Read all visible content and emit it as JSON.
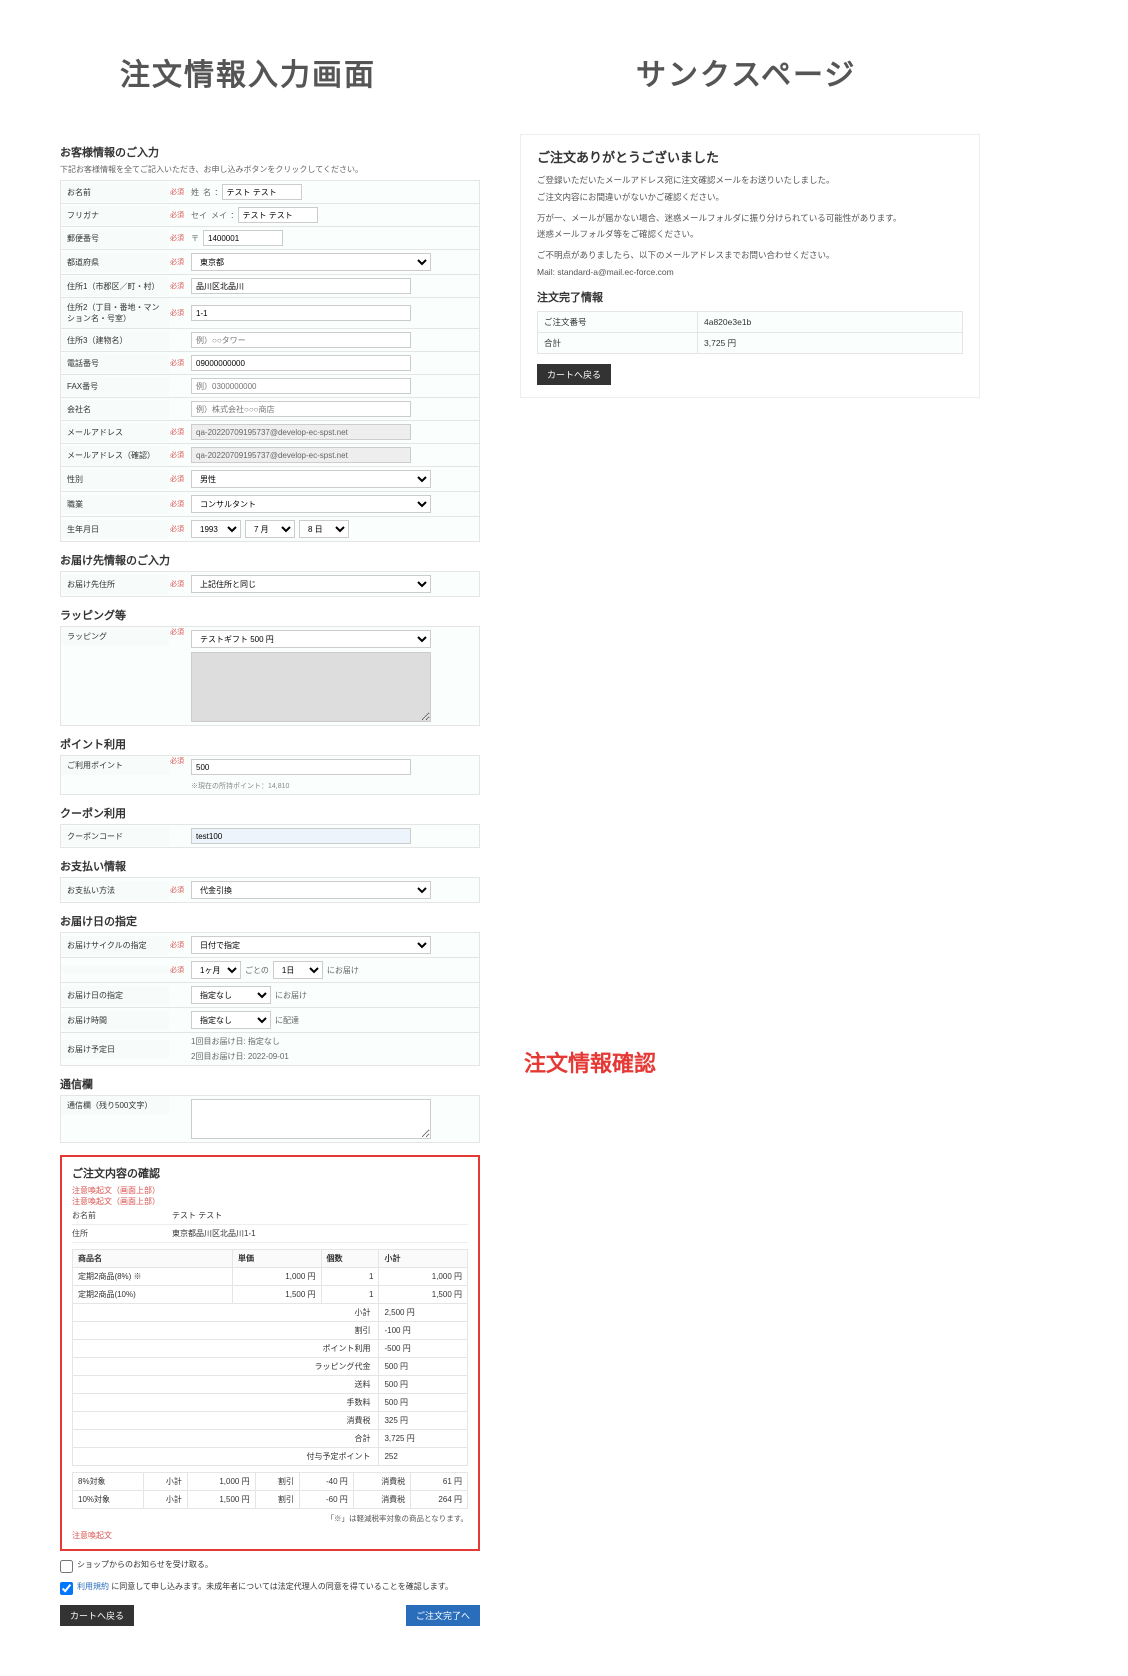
{
  "headings": {
    "left": "注文情報入力画面",
    "right": "サンクスページ",
    "confirm_overlay": "注文情報確認"
  },
  "form": {
    "section_customer": "お客様情報のご入力",
    "intro_note": "下記お客様情報を全てご記入いただき、お申し込みボタンをクリックしてください。",
    "required_label": "必須",
    "labels": {
      "name": "お名前",
      "kana": "フリガナ",
      "zip": "郵便番号",
      "pref": "都道府県",
      "addr1": "住所1（市郡区／町・村）",
      "addr2": "住所2（丁目・番地・マンション名・号室）",
      "addr3": "住所3（建物名）",
      "tel": "電話番号",
      "fax": "FAX番号",
      "company": "会社名",
      "email": "メールアドレス",
      "email2": "メールアドレス（確認）",
      "gender": "性別",
      "job": "職業",
      "birth": "生年月日"
    },
    "name_prefix_sei": "姓",
    "name_prefix_mei": "名",
    "name_value": "テスト テスト",
    "kana_prefix_sei": "セイ",
    "kana_prefix_mei": "メイ",
    "kana_value": "テスト テスト",
    "zip_prefix": "〒",
    "zip_value": "1400001",
    "pref_value": "東京都",
    "addr1_value": "品川区北品川",
    "addr2_value": "1-1",
    "addr3_placeholder": "例）○○タワー",
    "tel_value": "09000000000",
    "fax_placeholder": "例）0300000000",
    "company_placeholder": "例）株式会社○○○商店",
    "email_value": "qa-20220709195737@develop-ec-spst.net",
    "gender_value": "男性",
    "job_value": "コンサルタント",
    "birth_year": "1993",
    "birth_month": "7 月",
    "birth_day": "8 日",
    "section_delivery": "お届け先情報のご入力",
    "delivery_label": "お届け先住所",
    "delivery_value": "上記住所と同じ",
    "section_wrapping": "ラッピング等",
    "wrapping_label": "ラッピング",
    "wrapping_value": "テストギフト 500 円",
    "section_point": "ポイント利用",
    "point_label": "ご利用ポイント",
    "point_value": "500",
    "point_note": "※現在の所持ポイント：14,810",
    "section_coupon": "クーポン利用",
    "coupon_label": "クーポンコード",
    "coupon_value": "test100",
    "section_payment": "お支払い情報",
    "payment_label": "お支払い方法",
    "payment_value": "代金引換",
    "section_schedule": "お届け日の指定",
    "cycle_label": "お届けサイクルの指定",
    "cycle_value": "日付で指定",
    "cycle_month": "1ヶ月",
    "cycle_every": "ごとの",
    "cycle_day": "1日",
    "cycle_suffix": "にお届け",
    "deliv_date_label": "お届け日の指定",
    "deliv_date_value": "指定なし",
    "deliv_date_suffix": "にお届け",
    "deliv_time_label": "お届け時間",
    "deliv_time_value": "指定なし",
    "deliv_time_suffix": "に配達",
    "deliv_plan_label": "お届け予定日",
    "deliv_plan_value1": "1回目お届け日: 指定なし",
    "deliv_plan_value2": "2回目お届け日: 2022-09-01",
    "section_memo": "通信欄",
    "memo_label": "通信欄（残り500文字）"
  },
  "confirm": {
    "title": "ご注文内容の確認",
    "warn1": "注意喚起文（画面上部）",
    "warn2": "注意喚起文（画面上部）",
    "name_label": "お名前",
    "name_value": "テスト テスト",
    "addr_label": "住所",
    "addr_value": "東京都品川区北品川1-1",
    "th_product": "商品名",
    "th_price": "単価",
    "th_qty": "個数",
    "th_subtotal": "小計",
    "items": [
      {
        "name": "定期2商品(8%) ※",
        "price": "1,000 円",
        "qty": "1",
        "subtotal": "1,000 円"
      },
      {
        "name": "定期2商品(10%)",
        "price": "1,500 円",
        "qty": "1",
        "subtotal": "1,500 円"
      }
    ],
    "sums": [
      {
        "label": "小計",
        "value": "2,500 円"
      },
      {
        "label": "割引",
        "value": "-100 円"
      },
      {
        "label": "ポイント利用",
        "value": "-500 円"
      },
      {
        "label": "ラッピング代金",
        "value": "500 円"
      },
      {
        "label": "送料",
        "value": "500 円"
      },
      {
        "label": "手数料",
        "value": "500 円"
      },
      {
        "label": "消費税",
        "value": "325 円"
      },
      {
        "label": "合計",
        "value": "3,725 円"
      },
      {
        "label": "付与予定ポイント",
        "value": "252"
      }
    ],
    "tax_header": {
      "c1": "",
      "c2": "小計",
      "c3": "",
      "c4": "割引",
      "c5": "",
      "c6": "消費税",
      "c7": ""
    },
    "tax_rows": [
      {
        "rate": "8%対象",
        "sub_l": "小計",
        "sub": "1,000 円",
        "disc_l": "割引",
        "disc": "-40 円",
        "tax_l": "消費税",
        "tax": "61 円"
      },
      {
        "rate": "10%対象",
        "sub_l": "小計",
        "sub": "1,500 円",
        "disc_l": "割引",
        "disc": "-60 円",
        "tax_l": "消費税",
        "tax": "264 円"
      }
    ],
    "foot_note": "「※」は軽減税率対象の商品となります。",
    "bottom_warn": "注意喚起文",
    "newsletter": "ショップからのお知らせを受け取る。",
    "agree_prefix": "",
    "agree_link": "利用規約",
    "agree_suffix": " に同意して申し込みます。未成年者については法定代理人の同意を得ていることを確認します。",
    "btn_back": "カートへ戻る",
    "btn_next": "ご注文完了へ"
  },
  "thanks": {
    "title": "ご注文ありがとうございました",
    "p1": "ご登録いただいたメールアドレス宛に注文確認メールをお送りいたしました。",
    "p2": "ご注文内容にお間違いがないかご確認ください。",
    "p3": "万が一、メールが届かない場合、迷惑メールフォルダに振り分けられている可能性があります。",
    "p4": "迷惑メールフォルダ等をご確認ください。",
    "p5": "ご不明点がありましたら、以下のメールアドレスまでお問い合わせください。",
    "mail_label": "Mail: ",
    "mail_value": "standard-a@mail.ec-force.com",
    "sub_title": "注文完了情報",
    "order_no_label": "ご注文番号",
    "order_no_value": "4a820e3e1b",
    "total_label": "合計",
    "total_value": "3,725 円",
    "btn_back": "カートへ戻る"
  }
}
